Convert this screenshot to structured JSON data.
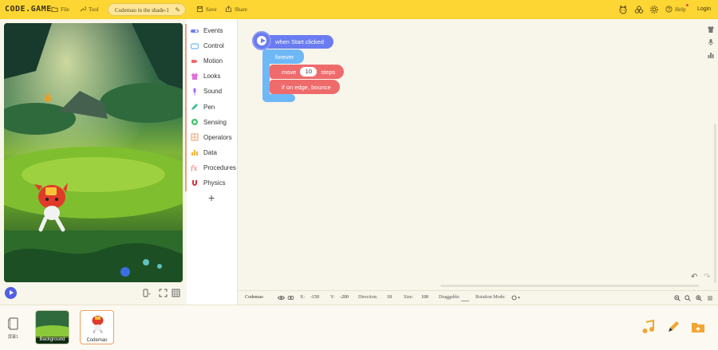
{
  "topbar": {
    "logo": "CODE.GAME",
    "file_label": "File",
    "tool_label": "Tool",
    "project_title": "Codemao in the shade-1",
    "save_label": "Save",
    "share_label": "Share",
    "help_label": "Help",
    "login_label": "Login"
  },
  "categories": [
    {
      "label": "Events",
      "color": "#6a7cf0"
    },
    {
      "label": "Control",
      "color": "#6fb8f7"
    },
    {
      "label": "Motion",
      "color": "#ef6b6b"
    },
    {
      "label": "Looks",
      "color": "#e46fd8"
    },
    {
      "label": "Sound",
      "color": "#a26ef0"
    },
    {
      "label": "Pen",
      "color": "#3fbf9c"
    },
    {
      "label": "Sensing",
      "color": "#3ec46a"
    },
    {
      "label": "Operators",
      "color": "#f29a6a"
    },
    {
      "label": "Data",
      "color": "#f2b134"
    },
    {
      "label": "Procedures",
      "color": "#e0706a"
    },
    {
      "label": "Physics",
      "color": "#d9333d"
    }
  ],
  "blocks": {
    "hat": "when Start clicked",
    "forever": "forever",
    "move_prefix": "move",
    "move_steps": "10",
    "move_suffix": "steps",
    "bounce": "if on edge, bounce"
  },
  "infobar": {
    "sprite_name": "Codemao",
    "x_label": "X:",
    "x_value": "-150",
    "y_label": "Y:",
    "y_value": "-200",
    "direction_label": "Direction:",
    "direction_value": "18",
    "size_label": "Size:",
    "size_value": "100",
    "draggable_label": "Draggable:",
    "rotation_label": "Rotation Mode:"
  },
  "spritebar": {
    "scene_label": "屏幕1",
    "background_label": "Background",
    "sprite_label": "Codemao"
  }
}
